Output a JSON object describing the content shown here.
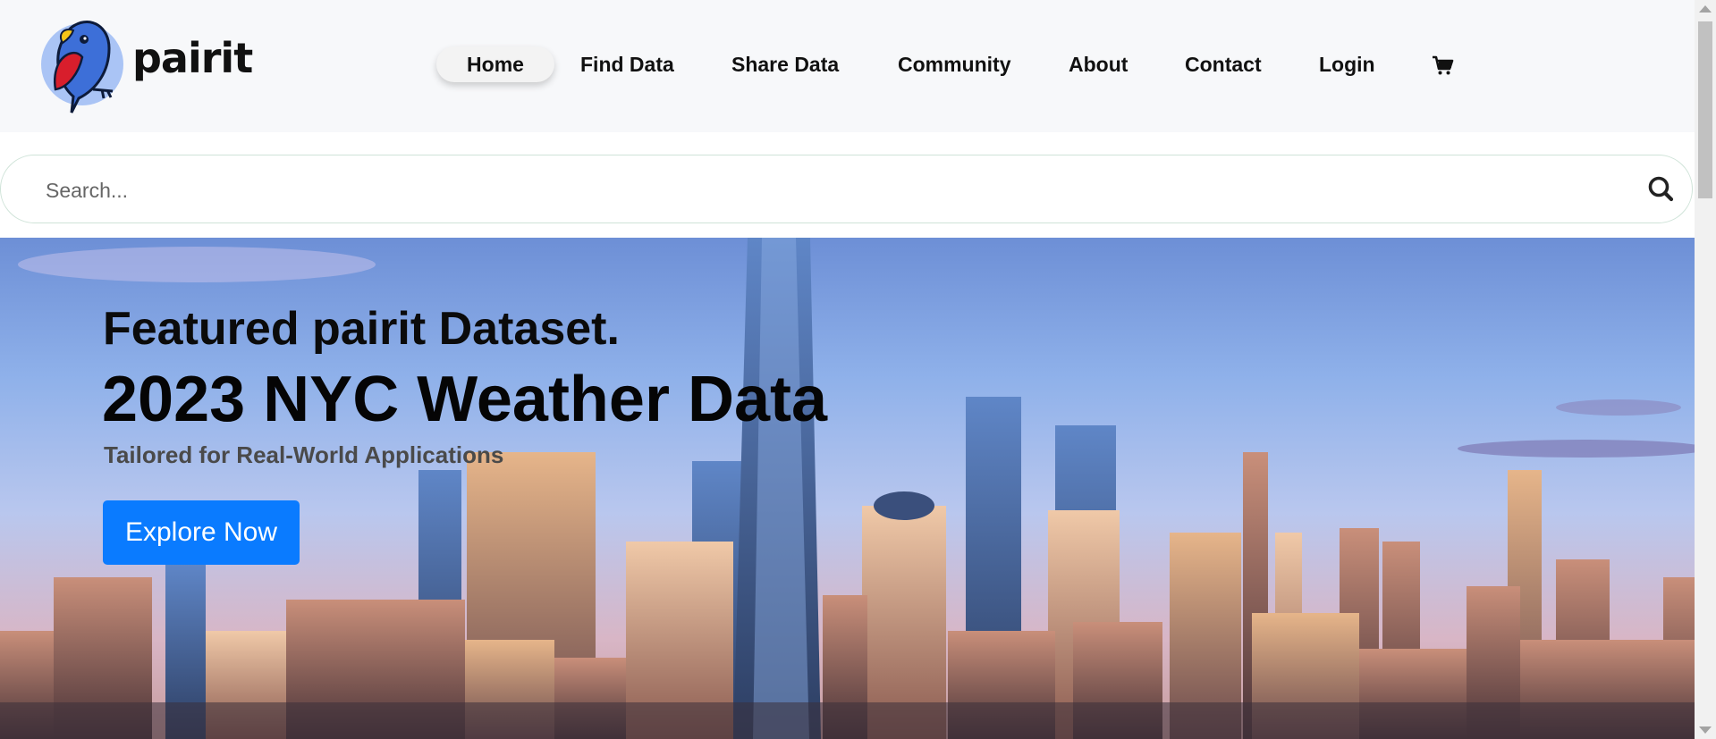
{
  "brand": {
    "name": "pairit",
    "logo_icon": "parrot-logo-icon",
    "colors": {
      "blue": "#3d6fd8",
      "red": "#d81e2c",
      "yellow": "#f5c518",
      "circle": "#aac4f5"
    }
  },
  "nav": {
    "items": [
      {
        "label": "Home",
        "active": true
      },
      {
        "label": "Find Data"
      },
      {
        "label": "Share Data"
      },
      {
        "label": "Community"
      },
      {
        "label": "About"
      },
      {
        "label": "Contact"
      },
      {
        "label": "Login"
      }
    ],
    "cart_icon": "cart-icon"
  },
  "search": {
    "placeholder": "Search...",
    "icon": "search-icon"
  },
  "hero": {
    "eyebrow": "Featured pairit Dataset.",
    "title": "2023 NYC Weather Data",
    "subtitle": "Tailored for Real-World Applications",
    "cta_label": "Explore Now",
    "cta_color": "#0a7bff",
    "background": "nyc-skyline-image"
  }
}
